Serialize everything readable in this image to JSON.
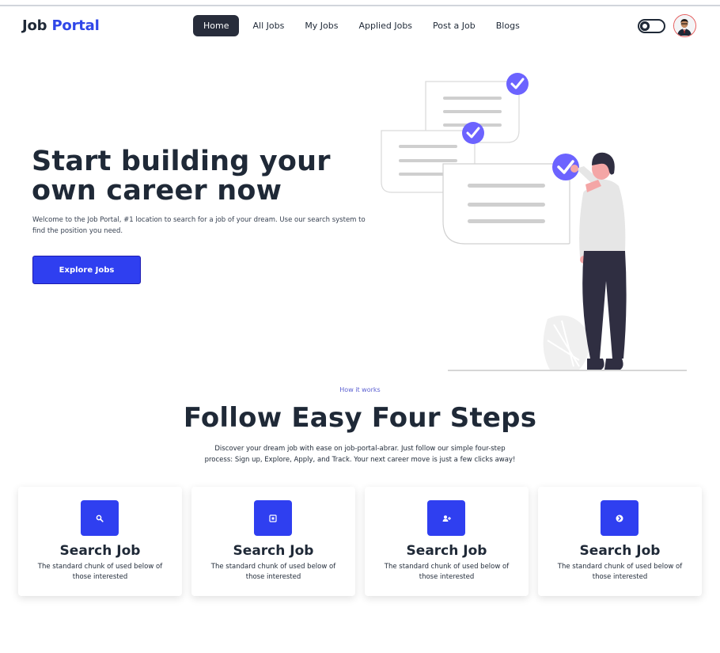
{
  "brand": {
    "part1": "Job",
    "part2": "Portal"
  },
  "nav": {
    "items": [
      {
        "label": "Home",
        "active": true
      },
      {
        "label": "All Jobs"
      },
      {
        "label": "My Jobs"
      },
      {
        "label": "Applied Jobs"
      },
      {
        "label": "Post a Job"
      },
      {
        "label": "Blogs"
      }
    ]
  },
  "hero": {
    "title": "Start building your own career now",
    "text": "Welcome to the Job Portal, #1 location to search for a job of your dream. Use our search system to find the position you need.",
    "cta": "Explore Jobs"
  },
  "how": {
    "eyebrow": "How it works",
    "title": "Follow Easy Four Steps",
    "text": "Discover your dream job with ease on job-portal-abrar. Just follow our simple four-step process: Sign up, Explore, Apply, and Track. Your next career move is just a few clicks away!",
    "cards": [
      {
        "icon": "search-icon",
        "title": "Search Job",
        "text": "The standard chunk of used below of those interested"
      },
      {
        "icon": "calendar-icon",
        "title": "Search Job",
        "text": "The standard chunk of used below of those interested"
      },
      {
        "icon": "add-user-icon",
        "title": "Search Job",
        "text": "The standard chunk of used below of those interested"
      },
      {
        "icon": "arrow-circle-icon",
        "title": "Search Job",
        "text": "The standard chunk of used below of those interested"
      }
    ]
  },
  "colors": {
    "accent": "#2f3ff0",
    "brand_accent": "#2f46e8",
    "dark": "#282d3b",
    "illustration_purple": "#6c63ff"
  }
}
